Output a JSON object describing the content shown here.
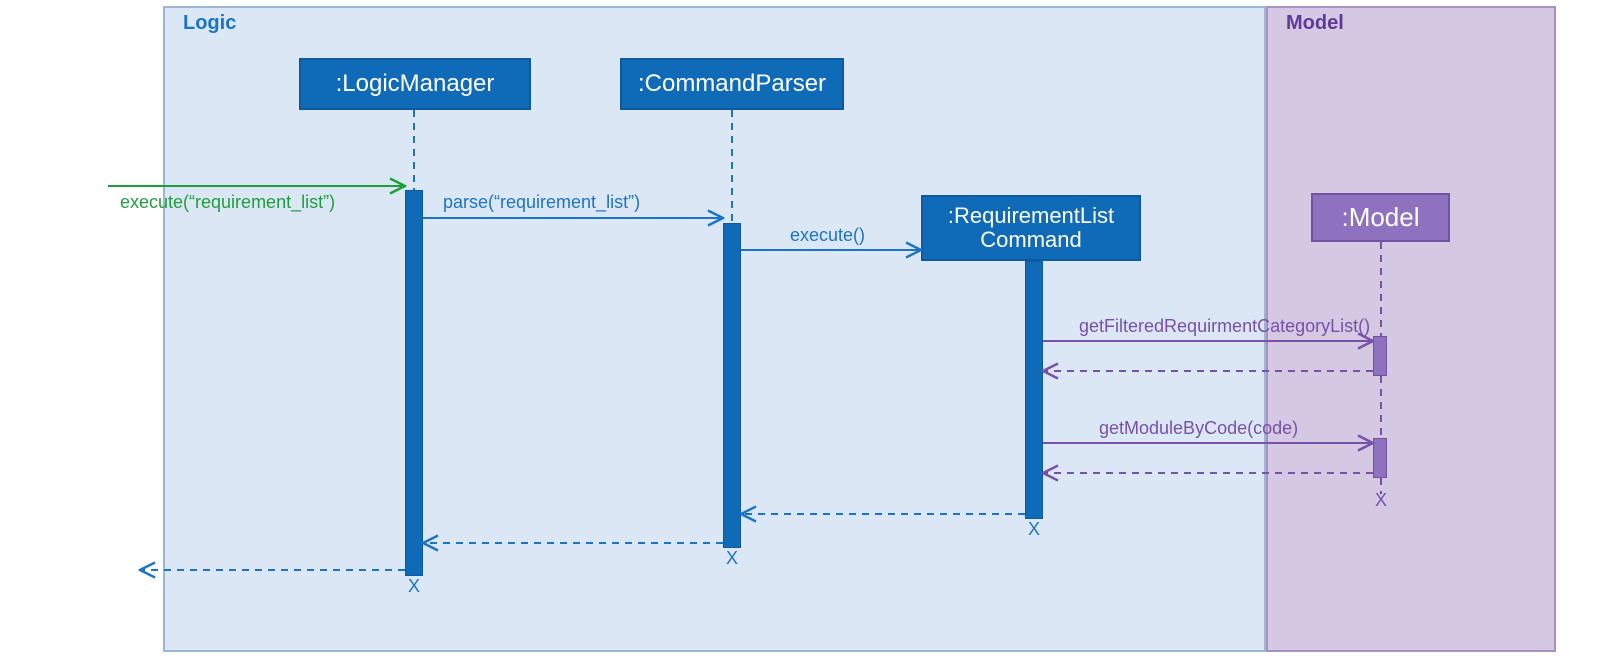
{
  "frames": {
    "logic": {
      "title": "Logic"
    },
    "model": {
      "title": "Model"
    }
  },
  "nodes": {
    "logicManager": {
      "label": ":LogicManager"
    },
    "commandParser": {
      "label": ":CommandParser"
    },
    "reqListCommand": {
      "label": ":RequirementList Command"
    },
    "model": {
      "label": ":Model"
    }
  },
  "messages": {
    "execIn": "execute(“requirement_list”)",
    "parse": "parse(“requirement_list”)",
    "execute": "execute()",
    "getFiltered": "getFilteredRequirmentCategoryList()",
    "getModule": "getModuleByCode(code)"
  },
  "termination": "X",
  "colors": {
    "blue": "#0f6bb8",
    "blueLine": "#1b74c5",
    "blueFrameBg": "#dbe7f4",
    "blueFrameBorder": "#9cb7d4",
    "green": "#1f9e3d",
    "purple": "#8e72bf",
    "purpleLine": "#7851a9",
    "purpleFrameBg": "#d5c8e2",
    "purpleFrameBorder": "#a991c4"
  }
}
